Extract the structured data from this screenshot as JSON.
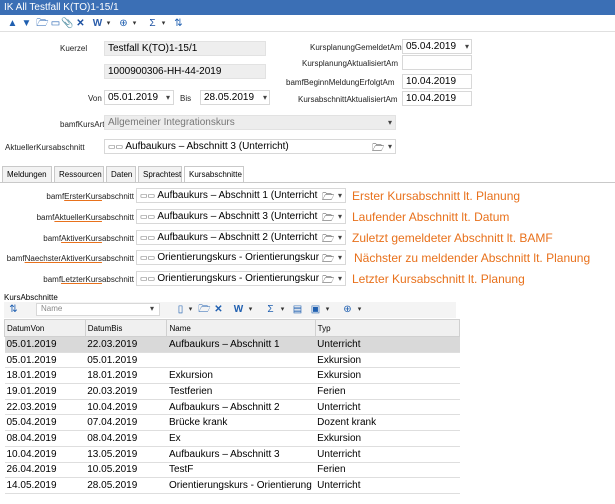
{
  "window": {
    "title": "IK All Testfall K(TO)1-15/1"
  },
  "toolbar": {
    "icons": [
      "arrow-up-icon",
      "arrow-down-icon",
      "folder-open-icon",
      "folder-icon",
      "paperclip-icon",
      "delete-icon",
      "word-icon",
      "chevron-down-icon",
      "globe-icon",
      "chevron-down-icon",
      "sum-icon",
      "chevron-down-icon",
      "sort-icon"
    ]
  },
  "form": {
    "kuerzel_label": "Kuerzel",
    "kuerzel_value": "Testfall K(TO)1-15/1",
    "code_value": "1000900306-HH-44-2019",
    "von_label": "Von",
    "von_value": "05.01.2019",
    "bis_label": "Bis",
    "bis_value": "28.05.2019",
    "kpga_label": "KursplanungGemeldetAm",
    "kpga_value": "05.04.2019",
    "kpaa_label": "KursplanungAktualisiertAm",
    "kpaa_value": "",
    "bbme_label": "bamfBeginnMeldungErfolgtAm",
    "bbme_value": "10.04.2019",
    "kaaa_label": "KursabschnittAktualisiertAm",
    "kaaa_value": "10.04.2019",
    "kursart_label": "bamfKursArt",
    "kursart_value": "Allgemeiner Integrationskurs",
    "aktueller_label": "AktuellerKursabschnitt",
    "aktueller_value": "Aufbaukurs – Abschnitt 3 (Unterricht)"
  },
  "tabs": [
    "Meldungen",
    "Ressourcen",
    "Daten",
    "Sprachtest",
    "Kursabschnitte"
  ],
  "active_tab": "Kursabschnitte",
  "abschnitte": [
    {
      "label_pre": "bamf",
      "label_u": "Erster",
      "label_mid": "Kurs",
      "label_post": "abschnitt",
      "value": "Aufbaukurs – Abschnitt 1 (Unterricht",
      "note": "Erster Kursabschnitt lt. Planung"
    },
    {
      "label_pre": "bamf",
      "label_u": "Aktueller",
      "label_mid": "Kurs",
      "label_post": "abschnitt",
      "value": "Aufbaukurs – Abschnitt 3 (Unterricht",
      "note": "Laufender Abschnitt lt. Datum"
    },
    {
      "label_pre": "bamf",
      "label_u": "Aktiver",
      "label_mid": "Kurs",
      "label_post": "abschnitt",
      "value": "Aufbaukurs – Abschnitt 2 (Unterricht",
      "note": "Zuletzt gemeldeter Abschnitt lt. BAMF"
    },
    {
      "label_pre": "bamf",
      "label_u": "NaechsterAktiver",
      "label_mid": "Kurs",
      "label_post": "abschnitt",
      "value": "Orientierungskurs - Orientierungskur",
      "note": "Nächster zu meldender Abschnitt lt. Planung"
    },
    {
      "label_pre": "bamf",
      "label_u": "Letzter",
      "label_mid": "Kurs",
      "label_post": "abschnitt",
      "value": "Orientierungskurs - Orientierungskur",
      "note": "Letzter Kursabschnitt lt. Planung"
    }
  ],
  "grid": {
    "title": "KursAbschnitte",
    "filter_placeholder": "Name",
    "columns": [
      "DatumVon",
      "DatumBis",
      "Name",
      "Typ"
    ],
    "rows": [
      [
        "05.01.2019",
        "22.03.2019",
        "Aufbaukurs – Abschnitt 1",
        "Unterricht"
      ],
      [
        "05.01.2019",
        "05.01.2019",
        "",
        "Exkursion"
      ],
      [
        "18.01.2019",
        "18.01.2019",
        "Exkursion",
        "Exkursion"
      ],
      [
        "19.01.2019",
        "20.03.2019",
        "Testferien",
        "Ferien"
      ],
      [
        "22.03.2019",
        "10.04.2019",
        "Aufbaukurs – Abschnitt 2",
        "Unterricht"
      ],
      [
        "05.04.2019",
        "07.04.2019",
        "Brücke krank",
        "Dozent krank"
      ],
      [
        "08.04.2019",
        "08.04.2019",
        "Ex",
        "Exkursion"
      ],
      [
        "10.04.2019",
        "13.05.2019",
        "Aufbaukurs – Abschnitt 3",
        "Unterricht"
      ],
      [
        "26.04.2019",
        "10.05.2019",
        "TestF",
        "Ferien"
      ],
      [
        "14.05.2019",
        "28.05.2019",
        "Orientierungskurs - Orientierung",
        "Unterricht"
      ]
    ],
    "selected_row": 0
  },
  "colors": {
    "titlebar": "#3b6fb5",
    "annotation": "#e8711c",
    "selected_row": "#d9d9d9"
  }
}
